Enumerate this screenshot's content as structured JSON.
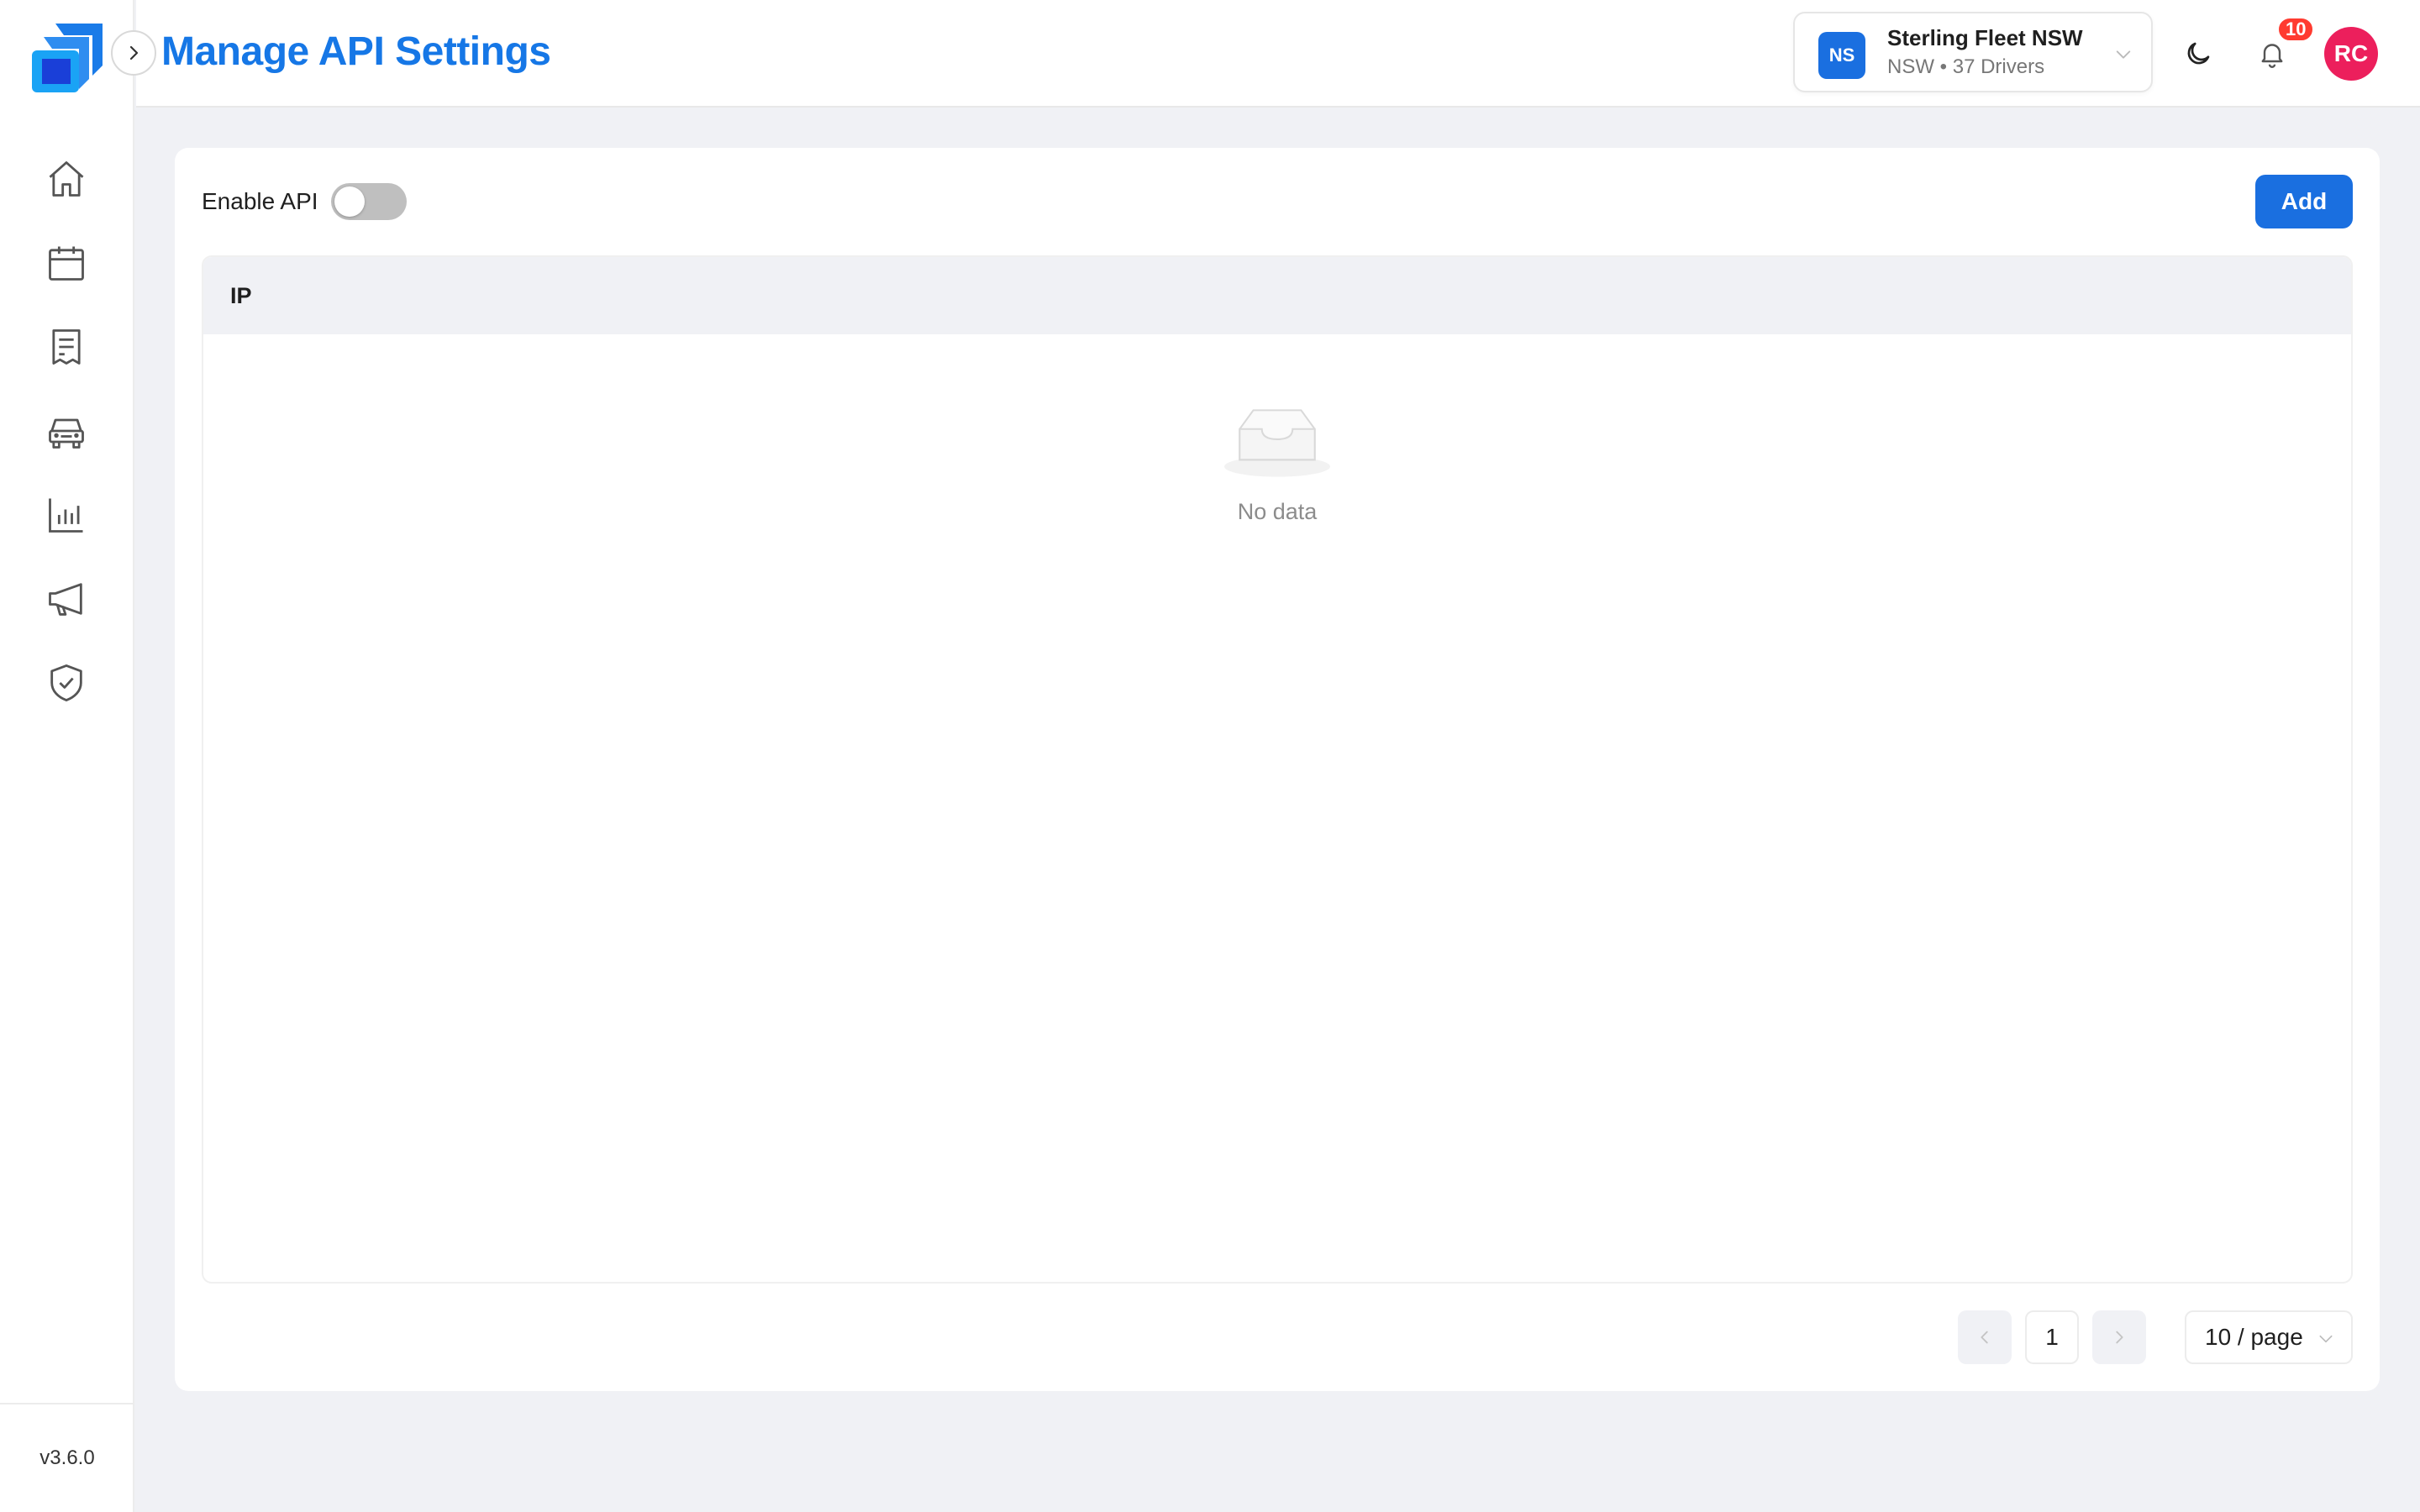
{
  "header": {
    "title": "Manage API Settings",
    "organization": {
      "initials": "NS",
      "name": "Sterling Fleet NSW",
      "subtitle": "NSW • 37 Drivers"
    },
    "notifications_count": "10",
    "user_initials": "RC"
  },
  "sidebar": {
    "items": [
      {
        "icon": "home-icon"
      },
      {
        "icon": "calendar-icon"
      },
      {
        "icon": "receipt-icon"
      },
      {
        "icon": "car-icon"
      },
      {
        "icon": "bar-chart-icon"
      },
      {
        "icon": "megaphone-icon"
      },
      {
        "icon": "shield-check-icon"
      }
    ],
    "version": "v3.6.0"
  },
  "api": {
    "enable_label": "Enable API",
    "enabled": false,
    "add_label": "Add",
    "table": {
      "columns": [
        "IP"
      ],
      "rows": [],
      "empty_text": "No data"
    },
    "pagination": {
      "current_page": "1",
      "page_size": "10 / page"
    }
  },
  "colors": {
    "accent": "#1a6fe0",
    "title": "#1677e6",
    "badge": "#ff3b30",
    "avatar": "#ec1f5c"
  }
}
